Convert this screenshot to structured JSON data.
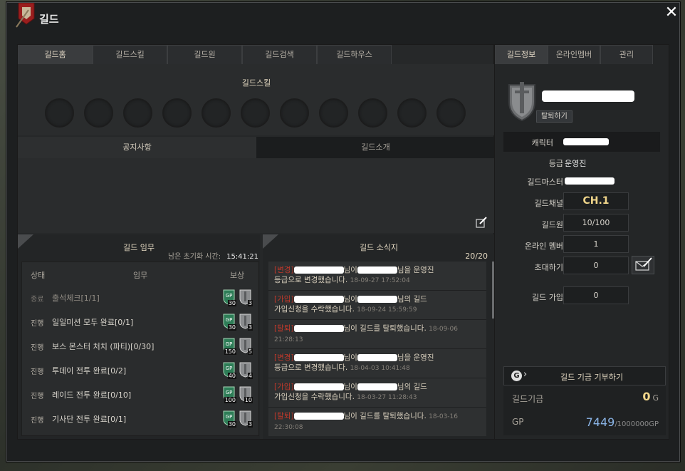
{
  "window": {
    "title": "길드"
  },
  "main_tabs": [
    "길드홈",
    "길드스킬",
    "길드원",
    "길드검색",
    "길드하우스"
  ],
  "skills": {
    "title": "길드스킬",
    "slot_count": 11
  },
  "notice_tabs": [
    "공지사항",
    "길드소개"
  ],
  "mission": {
    "title": "길드 임무",
    "reset_label": "남은 초기화 시간:",
    "reset_time": "15:41:21",
    "headers": {
      "status": "상태",
      "mission": "임무",
      "reward": "보상"
    },
    "rows": [
      {
        "status": "종료",
        "name": "출석체크[1/1]",
        "gp": "30",
        "shield": "3",
        "done": true
      },
      {
        "status": "진행",
        "name": "일일미션 모두 완료[0/1]",
        "gp": "30",
        "shield": "3",
        "done": false
      },
      {
        "status": "진행",
        "name": "보스 몬스터 처치 (파티)[0/30]",
        "gp": "150",
        "shield": "5",
        "done": false
      },
      {
        "status": "진행",
        "name": "투데이 전투 완료[0/2]",
        "gp": "40",
        "shield": "4",
        "done": false
      },
      {
        "status": "진행",
        "name": "레이드 전투 완료[0/10]",
        "gp": "100",
        "shield": "10",
        "done": false
      },
      {
        "status": "진행",
        "name": "기사단 전투 완료[0/1]",
        "gp": "30",
        "shield": "3",
        "done": false
      }
    ]
  },
  "news": {
    "title": "길드 소식지",
    "count": "20/20",
    "items": [
      {
        "tag": "[변경]",
        "mid": "님이",
        "tail": "님을 운영진",
        "line2": "등급으로 변경했습니다.",
        "date": "18-09-27 17:52:04"
      },
      {
        "tag": "[가입]",
        "mid": "님이",
        "tail": "님의 길드",
        "line2": "가입신청을 수락했습니다.",
        "date": "18-09-24 15:59:59"
      },
      {
        "tag": "[탈퇴]",
        "mid": "님이 길드를 탈퇴했습니다.",
        "tail": "",
        "line2": "",
        "date": "18-09-06 21:28:13"
      },
      {
        "tag": "[변경]",
        "mid": "님이",
        "tail": "님을 운영진",
        "line2": "등급으로 변경했습니다.",
        "date": "18-04-03 10:41:48"
      },
      {
        "tag": "[가입]",
        "mid": "님이",
        "tail": "님의 길드",
        "line2": "가입신청을 수락했습니다.",
        "date": "18-03-27 11:28:43"
      },
      {
        "tag": "[탈퇴]",
        "mid": "님이 길드를 탈퇴했습니다.",
        "tail": "",
        "line2": "",
        "date": "18-03-16 22:30:08"
      }
    ]
  },
  "side_tabs": [
    "길드정보",
    "온라인멤버",
    "관리"
  ],
  "guild_info": {
    "leave_button": "탈퇴하기",
    "character_label": "캐릭터",
    "grade_label": "등급",
    "grade_value": "운영진",
    "master_label": "길드마스터",
    "channel_label": "길드채널",
    "channel_value": "CH.1",
    "members_label": "길드원",
    "members_value": "10/100",
    "online_label": "온라인 멤버",
    "online_value": "1",
    "invite_label": "초대하기",
    "invite_value": "0",
    "join_label": "길드 가입",
    "join_value": "0"
  },
  "fund": {
    "donate_label": "길드 기금 기부하기",
    "fund_label": "길드기금",
    "fund_value": "0",
    "fund_unit": "G",
    "gp_label": "GP",
    "gp_value": "7449",
    "gp_max": "/1000000GP"
  }
}
